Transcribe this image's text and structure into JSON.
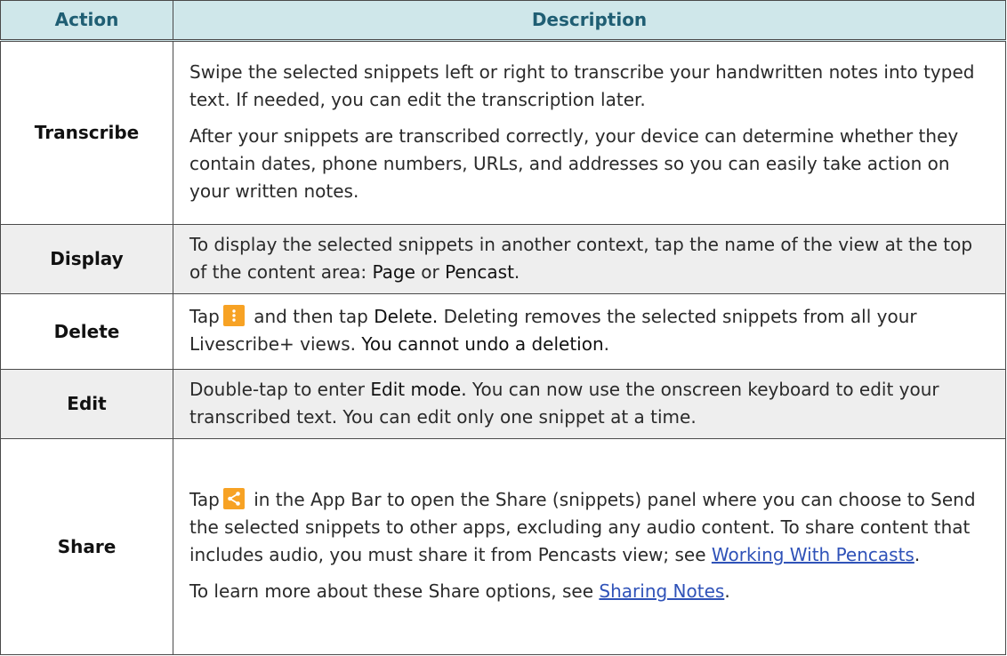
{
  "header": {
    "action": "Action",
    "description": "Description"
  },
  "colors": {
    "header_bg": "#cfe7ea",
    "header_text": "#1f5e73",
    "icon_orange": "#f7a224",
    "link": "#2f52b8"
  },
  "rows": [
    {
      "action": "Transcribe",
      "p1": "Swipe the selected snippets left or right to transcribe your handwritten notes into typed text. If needed, you can edit the transcription later.",
      "p2": "After your snippets are transcribed correctly, your device can determine whether they contain dates, phone numbers, URLs, and addresses so you can easily take action on your written notes."
    },
    {
      "action": "Display",
      "t1": "To display the selected snippets in another context, tap the name of the view at the top of the content area: ",
      "b1": "Page",
      "t2": " or ",
      "b2": "Pencast",
      "t3": "."
    },
    {
      "action": "Delete",
      "t1": "Tap",
      "icon": "more-vertical-icon",
      "t2": " and then tap ",
      "b1": "Delete.",
      "t3": " Deleting removes the selected snippets from all your Livescribe+ views. ",
      "b2": "You cannot undo a deletion",
      "t4": "."
    },
    {
      "action": "Edit",
      "t1": "Double-tap to enter ",
      "b1": "Edit mode.",
      "t2": " You can now use the onscreen keyboard to edit your transcribed text. You can edit only one snippet at a time."
    },
    {
      "action": "Share",
      "t1": "Tap",
      "icon": "share-icon",
      "t2": " in the App Bar to open the Share (snippets) panel where you can choose to Send the selected snippets to other apps, excluding any audio content. To share content that includes audio, you must share it from Pencasts view; see ",
      "link1": "Working With Pencasts",
      "t3": ".",
      "p2_text": "To learn more about these Share options, see ",
      "link2": "Sharing Notes",
      "p2_end": "."
    }
  ]
}
